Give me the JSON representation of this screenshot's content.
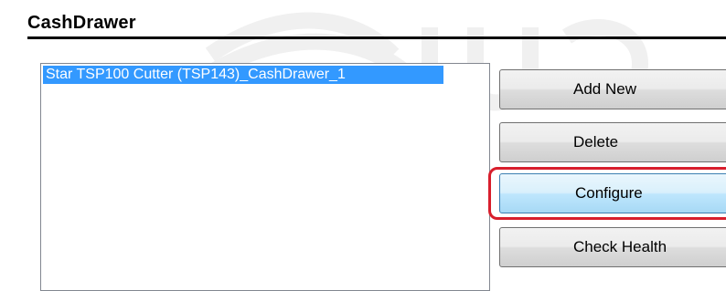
{
  "section": {
    "title": "CashDrawer"
  },
  "device_list": {
    "items": [
      "Star TSP100 Cutter (TSP143)_CashDrawer_1"
    ],
    "selected_index": 0
  },
  "buttons": {
    "add_new": "Add New",
    "delete": "Delete",
    "configure": "Configure",
    "check_health": "Check Health"
  },
  "colors": {
    "selection": "#3399ff",
    "highlight_ring": "#d81e2c",
    "configure_hover": "#bee6fd"
  }
}
